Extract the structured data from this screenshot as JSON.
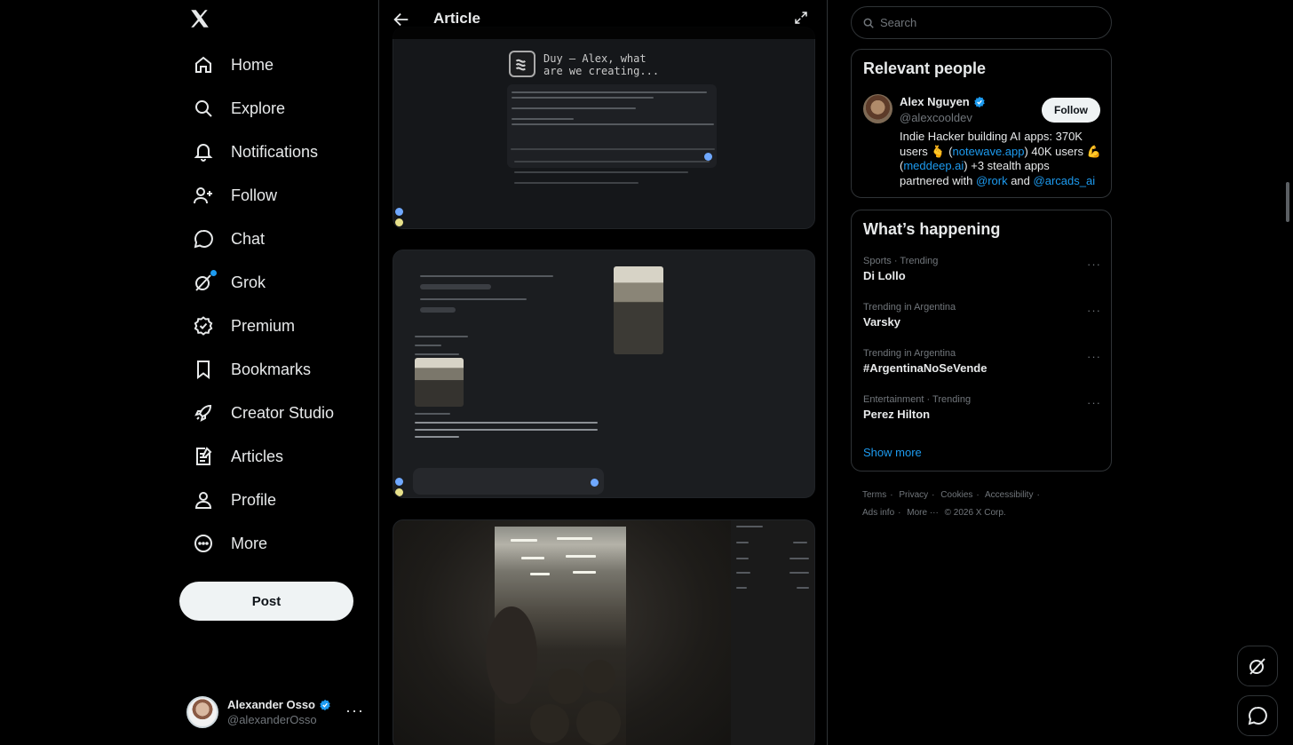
{
  "nav": {
    "items": [
      {
        "label": "Home",
        "icon": "home-icon"
      },
      {
        "label": "Explore",
        "icon": "search-icon"
      },
      {
        "label": "Notifications",
        "icon": "bell-icon"
      },
      {
        "label": "Follow",
        "icon": "person-plus-icon"
      },
      {
        "label": "Chat",
        "icon": "chat-bubble-icon"
      },
      {
        "label": "Grok",
        "icon": "grok-icon"
      },
      {
        "label": "Premium",
        "icon": "verified-badge-icon"
      },
      {
        "label": "Bookmarks",
        "icon": "bookmark-icon"
      },
      {
        "label": "Creator Studio",
        "icon": "rocket-icon"
      },
      {
        "label": "Articles",
        "icon": "article-icon"
      },
      {
        "label": "Profile",
        "icon": "person-icon"
      },
      {
        "label": "More",
        "icon": "more-circle-icon"
      }
    ],
    "post_label": "Post"
  },
  "account": {
    "name": "Alexander Osso",
    "handle": "@alexanderOsso"
  },
  "header": {
    "title": "Article"
  },
  "article_media": {
    "image1_text": "Duy – Alex, what\nare we creating..."
  },
  "search": {
    "placeholder": "Search"
  },
  "relevant_people": {
    "title": "Relevant people",
    "person": {
      "name": "Alex Nguyen",
      "handle": "@alexcooldev",
      "follow_label": "Follow",
      "bio_1": "Indie Hacker building AI apps: 370K users 🫰 (",
      "bio_link1": "notewave.app",
      "bio_2": ") 40K users 💪 (",
      "bio_link2": "meddeep.ai",
      "bio_3": ") +3 stealth apps partnered with ",
      "bio_link3": "@rork",
      "bio_4": " and ",
      "bio_link4": "@arcads_ai"
    }
  },
  "whats_happening": {
    "title": "What’s happening",
    "trends": [
      {
        "context": "Sports · Trending",
        "name": "Di Lollo"
      },
      {
        "context": "Trending in Argentina",
        "name": "Varsky"
      },
      {
        "context": "Trending in Argentina",
        "name": "#ArgentinaNoSeVende"
      },
      {
        "context": "Entertainment · Trending",
        "name": "Perez Hilton"
      }
    ],
    "show_more": "Show more"
  },
  "footer": {
    "links": [
      "Terms",
      "Privacy",
      "Cookies",
      "Accessibility",
      "Ads info",
      "More ···"
    ],
    "copyright": "© 2026 X Corp."
  },
  "colors": {
    "accent": "#1d9bf0",
    "background": "#000000",
    "border": "#2f3336"
  }
}
